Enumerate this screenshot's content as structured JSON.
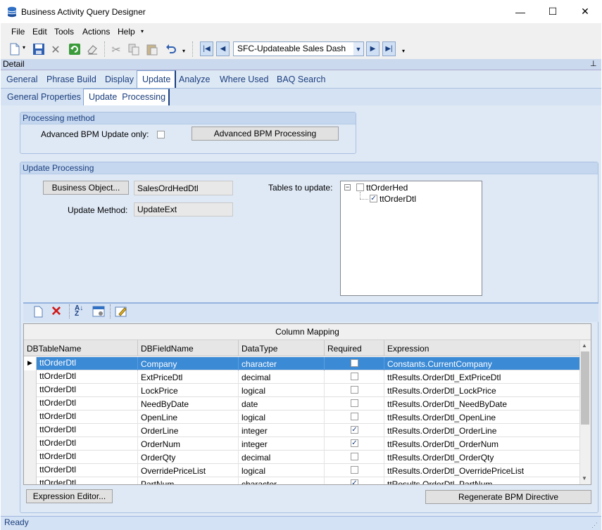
{
  "window": {
    "title": "Business Activity Query Designer",
    "controls": {
      "minimize": "—",
      "maximize": "☐",
      "close": "✕"
    }
  },
  "menu": [
    "File",
    "Edit",
    "Tools",
    "Actions",
    "Help"
  ],
  "toolbar": {
    "query_selector": "SFC-Updateable Sales Dash",
    "icons": [
      "new-icon",
      "save-icon",
      "delete-icon",
      "refresh-icon",
      "clear-icon",
      "cut-icon",
      "copy-icon",
      "paste-icon",
      "undo-icon"
    ]
  },
  "detail_header": "Detail",
  "tabs": [
    "General",
    "Phrase Build",
    "Display",
    "Update",
    "Analyze",
    "Where Used",
    "BAQ Search"
  ],
  "subtabs": [
    "General Properties",
    "Update  Processing"
  ],
  "processing_method": {
    "title": "Processing method",
    "advanced_label": "Advanced BPM Update only:",
    "advanced_checked": false,
    "advanced_button": "Advanced BPM Processing"
  },
  "update_processing": {
    "title": "Update Processing",
    "business_object_button": "Business Object...",
    "business_object_value": "SalesOrdHedDtl",
    "update_method_label": "Update Method:",
    "update_method_value": "UpdateExt",
    "tables_label": "Tables to update:",
    "tree": [
      {
        "label": "ttOrderHed",
        "checked": false,
        "expanded": true
      },
      {
        "label": "ttOrderDtl",
        "checked": true
      }
    ]
  },
  "grid": {
    "caption": "Column Mapping",
    "columns": [
      "DBTableName",
      "DBFieldName",
      "DataType",
      "Required",
      "Expression"
    ],
    "rows": [
      {
        "table": "ttOrderDtl",
        "field": "Company",
        "type": "character",
        "required": false,
        "expr": "Constants.CurrentCompany"
      },
      {
        "table": "ttOrderDtl",
        "field": "ExtPriceDtl",
        "type": "decimal",
        "required": false,
        "expr": "ttResults.OrderDtl_ExtPriceDtl"
      },
      {
        "table": "ttOrderDtl",
        "field": "LockPrice",
        "type": "logical",
        "required": false,
        "expr": "ttResults.OrderDtl_LockPrice"
      },
      {
        "table": "ttOrderDtl",
        "field": "NeedByDate",
        "type": "date",
        "required": false,
        "expr": "ttResults.OrderDtl_NeedByDate"
      },
      {
        "table": "ttOrderDtl",
        "field": "OpenLine",
        "type": "logical",
        "required": false,
        "expr": "ttResults.OrderDtl_OpenLine"
      },
      {
        "table": "ttOrderDtl",
        "field": "OrderLine",
        "type": "integer",
        "required": true,
        "expr": "ttResults.OrderDtl_OrderLine"
      },
      {
        "table": "ttOrderDtl",
        "field": "OrderNum",
        "type": "integer",
        "required": true,
        "expr": "ttResults.OrderDtl_OrderNum"
      },
      {
        "table": "ttOrderDtl",
        "field": "OrderQty",
        "type": "decimal",
        "required": false,
        "expr": "ttResults.OrderDtl_OrderQty"
      },
      {
        "table": "ttOrderDtl",
        "field": "OverridePriceList",
        "type": "logical",
        "required": false,
        "expr": "ttResults.OrderDtl_OverridePriceList"
      },
      {
        "table": "ttOrderDtl",
        "field": "PartNum",
        "type": "character",
        "required": true,
        "expr": "ttResults.OrderDtl_PartNum"
      }
    ]
  },
  "buttons": {
    "expression_editor": "Expression Editor...",
    "regenerate": "Regenerate BPM Directive"
  },
  "status": "Ready",
  "colors": {
    "accent": "#1b3f7e",
    "selected_row": "#3b8ad6",
    "panel_bg": "#dfe9f6"
  }
}
